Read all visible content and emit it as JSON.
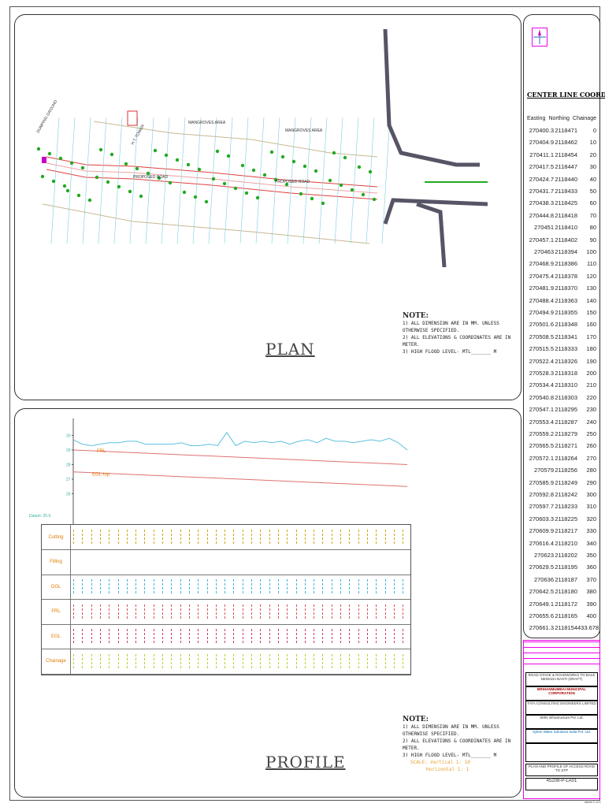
{
  "plan": {
    "title": "PLAN",
    "labels": {
      "dumping_ground": "DUMPING GROUND",
      "ht_tower": "H.T. TOWER",
      "mangroves_1": "MANGROVES AREA",
      "mangroves_2": "MANGROVES AREA",
      "proposed_road_1": "PROPOSED ROAD",
      "proposed_road_2": "PROPOSED ROAD"
    },
    "note": {
      "heading": "NOTE:",
      "lines": [
        "1) ALL DIMENSION ARE IN MM. UNLESS OTHERWISE SPECIFIED.",
        "2) ALL ELEVATIONS & COORDINATES ARE IN METER.",
        "3) HIGH FLOOD LEVEL-       MTL_______ M"
      ]
    }
  },
  "profile": {
    "title": "PROFILE",
    "datum": "Datum: 25.0",
    "y_ticks": [
      "30",
      "29",
      "28",
      "27",
      "26"
    ],
    "series_labels": {
      "frl": "FRL",
      "egl": "EGL-top"
    },
    "row_labels": [
      "Cutting",
      "Filling",
      "OGL",
      "FRL",
      "EGL",
      "Chainage"
    ],
    "row_colors": [
      "#d9a400",
      "#e07b00",
      "#39b4e0",
      "#e05050",
      "#c84060",
      "#b8d020"
    ],
    "ogl": [
      29.7,
      29.4,
      29.3,
      29.4,
      29.5,
      29.5,
      29.6,
      29.6,
      29.4,
      29.4,
      29.4,
      29.4,
      29.5,
      29.3,
      29.3,
      29.4,
      29.3,
      30.2,
      29.3,
      29.6,
      29.5,
      29.6,
      29.5,
      29.6,
      29.4,
      29.6,
      29.7,
      29.5,
      29.8,
      29.6,
      29.6,
      29.5,
      29.6,
      29.7,
      29.6,
      29.8,
      29.5,
      29.0
    ],
    "frl_range": [
      29.0,
      28.0
    ],
    "egl_range": [
      27.5,
      26.5
    ],
    "note": {
      "heading": "NOTE:",
      "lines": [
        "1) ALL DIMENSION ARE IN MM. UNLESS OTHERWISE SPECIFIED.",
        "2) ALL ELEVATIONS & COORDINATES ARE IN METER.",
        "3) HIGH FLOOD LEVEL-       MTL_______ M"
      ],
      "scale_label": "SCALE: Vertical 1: 10",
      "scale_h": "Horizontal 1: 1"
    }
  },
  "coordinates": {
    "heading": "CENTER LINE COORDINATES",
    "columns": [
      "Easting",
      "Northing",
      "Chainage"
    ],
    "rows": [
      [
        "270400.3",
        "2118471",
        "0"
      ],
      [
        "270404.9",
        "2118462",
        "10"
      ],
      [
        "270411.1",
        "2118454",
        "20"
      ],
      [
        "270417.5",
        "2118447",
        "30"
      ],
      [
        "270424.7",
        "2118440",
        "40"
      ],
      [
        "270431.7",
        "2118433",
        "50"
      ],
      [
        "270438.3",
        "2118425",
        "60"
      ],
      [
        "270444.8",
        "2118418",
        "70"
      ],
      [
        "270451",
        "2118410",
        "80"
      ],
      [
        "270457.1",
        "2118402",
        "90"
      ],
      [
        "270463",
        "2118394",
        "100"
      ],
      [
        "270468.9",
        "2118386",
        "110"
      ],
      [
        "270475.4",
        "2118378",
        "120"
      ],
      [
        "270481.9",
        "2118370",
        "130"
      ],
      [
        "270488.4",
        "2118363",
        "140"
      ],
      [
        "270494.9",
        "2118355",
        "150"
      ],
      [
        "270501.6",
        "2118348",
        "160"
      ],
      [
        "270508.5",
        "2118341",
        "170"
      ],
      [
        "270515.5",
        "2118333",
        "180"
      ],
      [
        "270522.4",
        "2118326",
        "190"
      ],
      [
        "270528.3",
        "2118318",
        "200"
      ],
      [
        "270534.4",
        "2118310",
        "210"
      ],
      [
        "270540.8",
        "2118303",
        "220"
      ],
      [
        "270547.1",
        "2118295",
        "230"
      ],
      [
        "270553.4",
        "2118287",
        "240"
      ],
      [
        "270559.2",
        "2118279",
        "250"
      ],
      [
        "270565.5",
        "2118271",
        "260"
      ],
      [
        "270572.1",
        "2118264",
        "270"
      ],
      [
        "270579",
        "2118256",
        "280"
      ],
      [
        "270585.9",
        "2118249",
        "290"
      ],
      [
        "270592.8",
        "2118242",
        "300"
      ],
      [
        "270597.7",
        "2118233",
        "310"
      ],
      [
        "270603.3",
        "2118225",
        "320"
      ],
      [
        "270609.9",
        "2118217",
        "330"
      ],
      [
        "270616.4",
        "2118210",
        "340"
      ],
      [
        "270623",
        "2118202",
        "350"
      ],
      [
        "270629.5",
        "2118195",
        "360"
      ],
      [
        "270636",
        "2118187",
        "370"
      ],
      [
        "270642.5",
        "2118180",
        "380"
      ],
      [
        "270649.1",
        "2118172",
        "390"
      ],
      [
        "270655.6",
        "2118165",
        "400"
      ],
      [
        "270661.3",
        "2118154",
        "433.678"
      ]
    ]
  },
  "title_block": {
    "project": "ROAD STAGE & ROADWORKS TO BALE NEWADA BASTI (DRAFT)",
    "client": "BRIHANMUMBAI MUNICIPAL CORPORATION",
    "consultant": "TATA CONSULTING ENGINEERS LIMITED",
    "contractor": "SMN Infrastructure Pvt. Ltd.",
    "designer": "Xylem Water Solutions India Pvt. Ltd.",
    "drawing_title": "PLAN AND PROFILE OF ACCESS ROAD TO STP",
    "drawing_no": "45208-P-LA01",
    "footer": "sheet 1 of 1"
  },
  "colors": {
    "road": "#e04040",
    "ogl": "#5ec0e0",
    "tree": "#22aa22",
    "boundary": "#c8b890",
    "section": "#80d0e0"
  }
}
